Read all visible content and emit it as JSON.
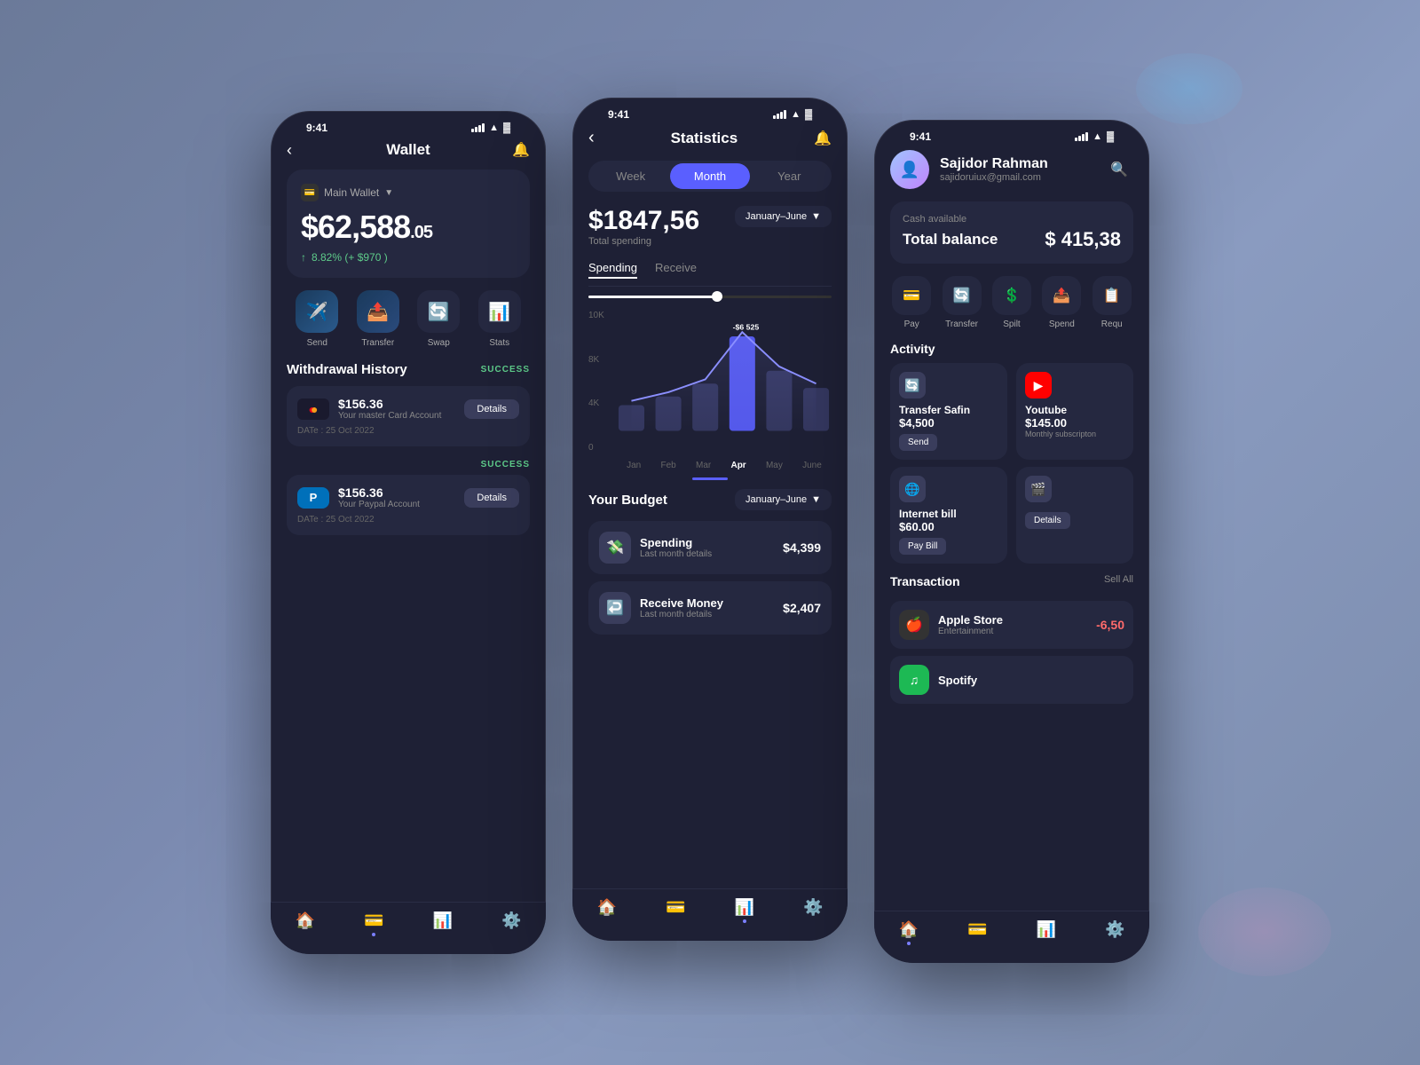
{
  "phone1": {
    "status_time": "9:41",
    "title": "Wallet",
    "wallet_label": "Main Wallet",
    "balance_main": "$62,588",
    "balance_cents": ".05",
    "balance_change": "8.82% (+ $970 )",
    "actions": [
      {
        "icon": "✈️",
        "label": "Send"
      },
      {
        "icon": "📤",
        "label": "Transfer"
      },
      {
        "icon": "🔄",
        "label": "Swap"
      },
      {
        "icon": "📊",
        "label": "Stats"
      }
    ],
    "history_title": "Withdrawal History",
    "history_badge": "SUCCESS",
    "history_items": [
      {
        "amount": "$156.36",
        "sub": "Your master Card Account",
        "date": "DATe : 25 Oct 2022",
        "icon": "💳",
        "type": "mastercard"
      },
      {
        "amount": "$156.36",
        "sub": "Your Paypal Account",
        "date": "DATe : 25 Oct 2022",
        "icon": "🅿️",
        "type": "paypal"
      }
    ],
    "details_label": "Details",
    "nav": [
      "🏠",
      "💳",
      "📊",
      "⚙️"
    ]
  },
  "phone2": {
    "status_time": "9:41",
    "title": "Statistics",
    "back": "‹",
    "notif": "🔔",
    "tabs": [
      "Week",
      "Month",
      "Year"
    ],
    "active_tab": "Month",
    "total_spending_label": "Total spending",
    "total_spending": "$1847,56",
    "range": "January–June",
    "chart_tabs": [
      "Spending",
      "Receive"
    ],
    "active_chart_tab": "Spending",
    "y_labels": [
      "10K",
      "8K",
      "4K",
      "0"
    ],
    "x_labels": [
      "Jan",
      "Feb",
      "Mar",
      "Apr",
      "May",
      "June"
    ],
    "highlight_label": "-$6 525",
    "highlight_x": "Apr",
    "budget_title": "Your Budget",
    "budget_range": "January–June",
    "budget_items": [
      {
        "icon": "💸",
        "name": "Spending",
        "sub": "Last month details",
        "amount": "$4,399"
      },
      {
        "icon": "↩️",
        "name": "Receive Money",
        "sub": "Last month details",
        "amount": "$2,407"
      }
    ],
    "nav": [
      "🏠",
      "💳",
      "📊",
      "⚙️"
    ]
  },
  "phone3": {
    "status_time": "9:41",
    "name": "Sajidor Rahman",
    "email": "sajidoruiux@gmail.com",
    "cash_label": "Cash available",
    "balance_title": "Total balance",
    "balance_amount": "$ 415,38",
    "quick_actions": [
      {
        "icon": "💳",
        "label": "Pay"
      },
      {
        "icon": "🔄",
        "label": "Transfer"
      },
      {
        "icon": "💲",
        "label": "Spilt"
      },
      {
        "icon": "📤",
        "label": "Spend"
      },
      {
        "icon": "📋",
        "label": "Requ"
      }
    ],
    "activity_title": "Activity",
    "activity_items": [
      {
        "icon": "🔄",
        "name": "Transfer Safin",
        "amount": "$4,500",
        "btn": "Send"
      },
      {
        "icon": "▶️",
        "name": "Youtube",
        "amount": "$145.00",
        "sub": "Monthly subscripton"
      }
    ],
    "activity2_items": [
      {
        "icon": "🌐",
        "name": "Internet bill",
        "amount": "$60.00",
        "btn": "Pay Bill"
      },
      {
        "icon": "🎬",
        "name": "",
        "btn": "Details"
      }
    ],
    "transaction_title": "Transaction",
    "sell_all": "Sell All",
    "transactions": [
      {
        "icon": "🍎",
        "name": "Apple Store",
        "sub": "Entertainment",
        "amount": "-6,50"
      },
      {
        "icon": "🎵",
        "name": "Spotify",
        "sub": "",
        "amount": ""
      }
    ],
    "nav": [
      "🏠",
      "💳",
      "📊",
      "⚙️"
    ]
  }
}
